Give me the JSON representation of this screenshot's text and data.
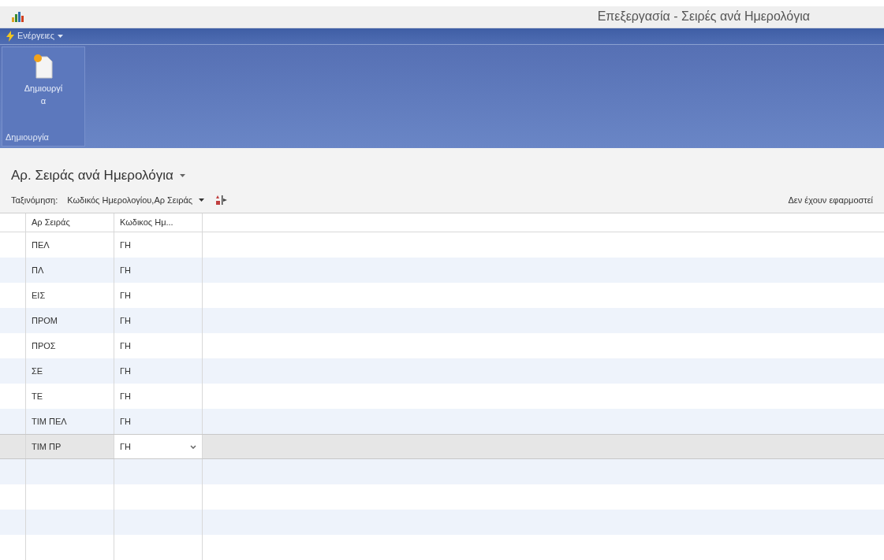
{
  "window": {
    "title": "Επεξεργασία - Σειρές ανά Ημερολόγια"
  },
  "menu": {
    "label": "Ενέργειες"
  },
  "ribbon": {
    "buttons": [
      {
        "label": "Δημιουργία"
      }
    ],
    "group_label": "Δημιουργία"
  },
  "page": {
    "heading": "Αρ. Σειράς ανά Ημερολόγια",
    "sort_label": "Ταξινόμηση:",
    "sort_value": "Κωδικός Ημερολογίου,Αρ Σειράς",
    "filter_status": "Δεν έχουν εφαρμοστεί"
  },
  "table": {
    "columns": [
      "Αρ Σειράς",
      "Κωδικος Ημ..."
    ],
    "rows": [
      {
        "cells": [
          "ΠΕΛ",
          "ΓΗ"
        ],
        "selected": false
      },
      {
        "cells": [
          "ΠΛ",
          "ΓΗ"
        ],
        "selected": false
      },
      {
        "cells": [
          "ΕΙΣ",
          "ΓΗ"
        ],
        "selected": false
      },
      {
        "cells": [
          "ΠΡΟΜ",
          "ΓΗ"
        ],
        "selected": false
      },
      {
        "cells": [
          "ΠΡΟΣ",
          "ΓΗ"
        ],
        "selected": false
      },
      {
        "cells": [
          "ΣΕ",
          "ΓΗ"
        ],
        "selected": false
      },
      {
        "cells": [
          "ΤΕ",
          "ΓΗ"
        ],
        "selected": false
      },
      {
        "cells": [
          "ΤΙΜ ΠΕΛ",
          "ΓΗ"
        ],
        "selected": false
      },
      {
        "cells": [
          "ΤΙΜ ΠΡ",
          "ΓΗ"
        ],
        "selected": true
      }
    ]
  }
}
